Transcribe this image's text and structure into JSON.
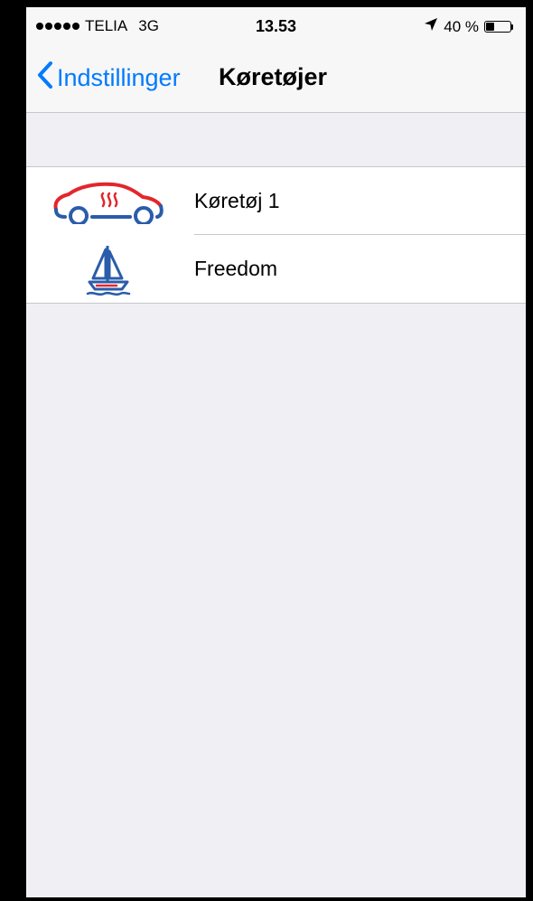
{
  "status_bar": {
    "carrier": "TELIA",
    "network": "3G",
    "time": "13.53",
    "battery_text": "40 %",
    "battery_level": 0.4,
    "signal_bars": 5
  },
  "nav": {
    "back_label": "Indstillinger",
    "title": "Køretøjer"
  },
  "vehicles": [
    {
      "label": "Køretøj 1",
      "icon": "car-heater-icon"
    },
    {
      "label": "Freedom",
      "icon": "sailboat-icon"
    }
  ],
  "colors": {
    "accent": "#007aff",
    "car_red": "#e3262c",
    "icon_blue": "#2a5caa",
    "background": "#efeff4"
  }
}
